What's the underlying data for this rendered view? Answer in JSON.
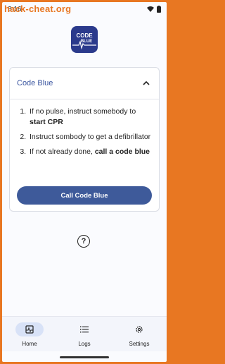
{
  "status": {
    "time": "3:16"
  },
  "watermark": "hack-cheat.org",
  "logo": {
    "line1": "CODE",
    "line2": "BLUE"
  },
  "card": {
    "title": "Code Blue",
    "steps": [
      {
        "text": "If no pulse, instruct somebody to ",
        "bold": "start CPR"
      },
      {
        "text": "Instruct sombody to get a defibrillator",
        "bold": ""
      },
      {
        "text": "If not already done, ",
        "bold": "call a code blue"
      }
    ],
    "button_label": "Call Code Blue"
  },
  "nav": [
    {
      "label": "Home",
      "icon": "heart-monitor-icon",
      "active": true
    },
    {
      "label": "Logs",
      "icon": "list-icon",
      "active": false
    },
    {
      "label": "Settings",
      "icon": "gear-icon",
      "active": false
    }
  ],
  "colors": {
    "frame": "#e87722",
    "brand": "#2b3a8c",
    "button": "#3e5a9a",
    "title": "#3a55a0"
  }
}
